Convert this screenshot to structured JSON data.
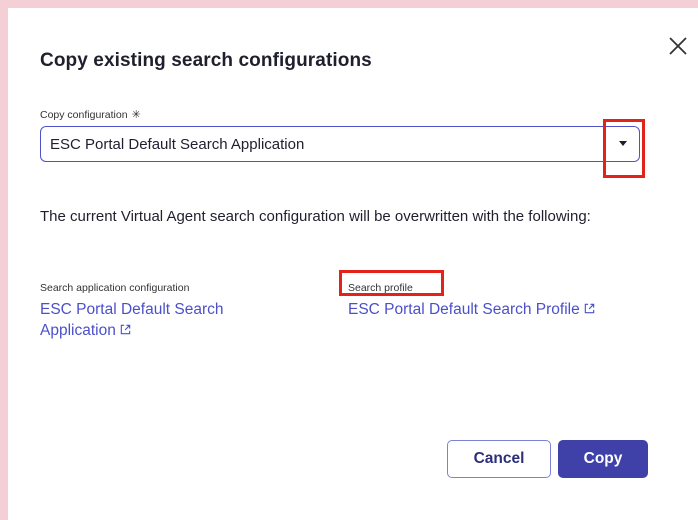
{
  "dialog": {
    "title": "Copy existing search configurations",
    "close_icon": "close-icon",
    "copy_configuration": {
      "label": "Copy configuration",
      "required_marker": "✳",
      "selected_value": "ESC Portal Default Search Application"
    },
    "description": "The current Virtual Agent search configuration will be overwritten with the following:",
    "search_application": {
      "label": "Search application configuration",
      "link_text": "ESC Portal Default Search Application",
      "icon": "external-link-icon"
    },
    "search_profile": {
      "label": "Search profile",
      "link_text": "ESC Portal Default Search Profile",
      "icon": "external-link-icon"
    },
    "buttons": {
      "cancel": "Cancel",
      "copy": "Copy"
    }
  },
  "colors": {
    "backdrop": "#f5cfd6",
    "accent": "#3f41a8",
    "link": "#4b50c9",
    "highlight": "#e2231a"
  }
}
